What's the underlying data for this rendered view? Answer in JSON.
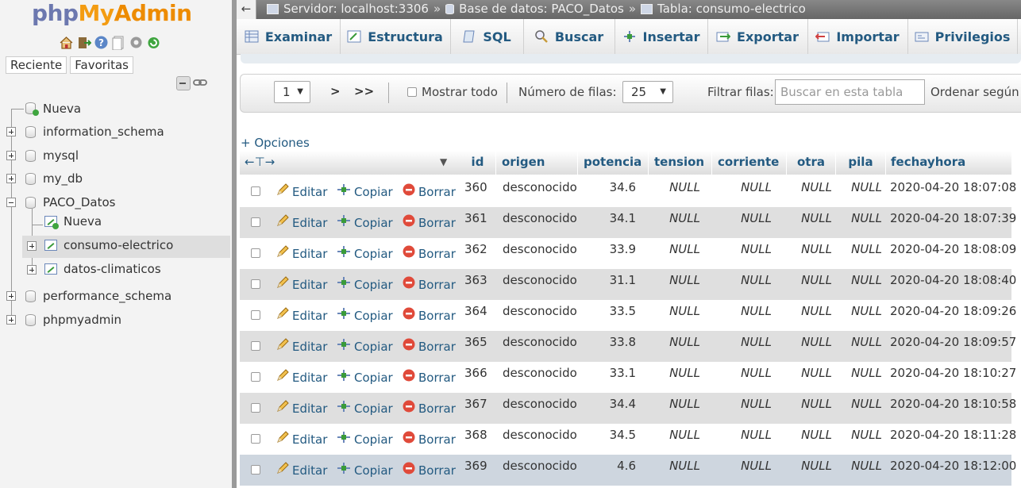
{
  "logo": {
    "php": "php",
    "my": "My",
    "admin": "Admin"
  },
  "nav": {
    "tabs": [
      "Reciente",
      "Favoritas"
    ],
    "tree": {
      "new": "Nueva",
      "databases": [
        "information_schema",
        "mysql",
        "my_db",
        "PACO_Datos"
      ],
      "paco_children": {
        "new": "Nueva",
        "tables": [
          "consumo-electrico",
          "datos-climaticos"
        ]
      },
      "more_databases": [
        "performance_schema",
        "phpmyadmin"
      ]
    }
  },
  "breadcrumb": {
    "server": "Servidor: localhost:3306",
    "database": "Base de datos: PACO_Datos",
    "table": "Tabla: consumo-electrico",
    "separator": "»"
  },
  "menu_tabs": [
    "Examinar",
    "Estructura",
    "SQL",
    "Buscar",
    "Insertar",
    "Exportar",
    "Importar",
    "Privilegios"
  ],
  "pagination": {
    "page": "1",
    "next": ">",
    "last": ">>",
    "show_all": "Mostrar todo",
    "rows_label": "Número de filas:",
    "rows_value": "25",
    "filter_label": "Filtrar filas:",
    "filter_placeholder": "Buscar en esta tabla",
    "sort_label": "Ordenar según la"
  },
  "options_link": "+ Opciones",
  "columns": [
    "id",
    "origen",
    "potencia",
    "tension",
    "corriente",
    "otra",
    "pila",
    "fechayhora"
  ],
  "row_actions": {
    "edit": "Editar",
    "copy": "Copiar",
    "delete": "Borrar"
  },
  "rows": [
    {
      "id": "360",
      "origen": "desconocido",
      "potencia": "34.6",
      "tension": "NULL",
      "corriente": "NULL",
      "otra": "NULL",
      "pila": "NULL",
      "fechayhora": "2020-04-20 18:07:08"
    },
    {
      "id": "361",
      "origen": "desconocido",
      "potencia": "34.1",
      "tension": "NULL",
      "corriente": "NULL",
      "otra": "NULL",
      "pila": "NULL",
      "fechayhora": "2020-04-20 18:07:39"
    },
    {
      "id": "362",
      "origen": "desconocido",
      "potencia": "33.9",
      "tension": "NULL",
      "corriente": "NULL",
      "otra": "NULL",
      "pila": "NULL",
      "fechayhora": "2020-04-20 18:08:09"
    },
    {
      "id": "363",
      "origen": "desconocido",
      "potencia": "31.1",
      "tension": "NULL",
      "corriente": "NULL",
      "otra": "NULL",
      "pila": "NULL",
      "fechayhora": "2020-04-20 18:08:40"
    },
    {
      "id": "364",
      "origen": "desconocido",
      "potencia": "33.5",
      "tension": "NULL",
      "corriente": "NULL",
      "otra": "NULL",
      "pila": "NULL",
      "fechayhora": "2020-04-20 18:09:26"
    },
    {
      "id": "365",
      "origen": "desconocido",
      "potencia": "33.8",
      "tension": "NULL",
      "corriente": "NULL",
      "otra": "NULL",
      "pila": "NULL",
      "fechayhora": "2020-04-20 18:09:57"
    },
    {
      "id": "366",
      "origen": "desconocido",
      "potencia": "33.1",
      "tension": "NULL",
      "corriente": "NULL",
      "otra": "NULL",
      "pila": "NULL",
      "fechayhora": "2020-04-20 18:10:27"
    },
    {
      "id": "367",
      "origen": "desconocido",
      "potencia": "34.4",
      "tension": "NULL",
      "corriente": "NULL",
      "otra": "NULL",
      "pila": "NULL",
      "fechayhora": "2020-04-20 18:10:58"
    },
    {
      "id": "368",
      "origen": "desconocido",
      "potencia": "34.5",
      "tension": "NULL",
      "corriente": "NULL",
      "otra": "NULL",
      "pila": "NULL",
      "fechayhora": "2020-04-20 18:11:28"
    },
    {
      "id": "369",
      "origen": "desconocido",
      "potencia": "4.6",
      "tension": "NULL",
      "corriente": "NULL",
      "otra": "NULL",
      "pila": "NULL",
      "fechayhora": "2020-04-20 18:12:00"
    }
  ]
}
